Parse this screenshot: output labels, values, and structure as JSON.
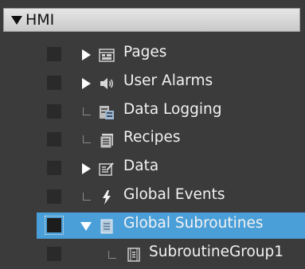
{
  "root": {
    "label": "HMI",
    "expanded": true,
    "icon": "caret-down-icon"
  },
  "items": [
    {
      "label": "Pages",
      "icon": "pages-icon",
      "expander": "caret-right"
    },
    {
      "label": "User Alarms",
      "icon": "speaker-icon",
      "expander": "caret-right"
    },
    {
      "label": "Data Logging",
      "icon": "data-logging-icon",
      "expander": "none"
    },
    {
      "label": "Recipes",
      "icon": "recipes-icon",
      "expander": "none"
    },
    {
      "label": "Data",
      "icon": "data-icon",
      "expander": "caret-right"
    },
    {
      "label": "Global Events",
      "icon": "lightning-icon",
      "expander": "none"
    },
    {
      "label": "Global Subroutines",
      "icon": "global-subroutines-icon",
      "expander": "caret-down",
      "selected": true
    },
    {
      "label": "SubroutineGroup1",
      "icon": "subroutine-group-icon",
      "expander": "none",
      "child": true
    }
  ],
  "colors": {
    "background": "#3b3b3b",
    "selection": "#4a9fd8",
    "text": "#f2f2f2"
  }
}
